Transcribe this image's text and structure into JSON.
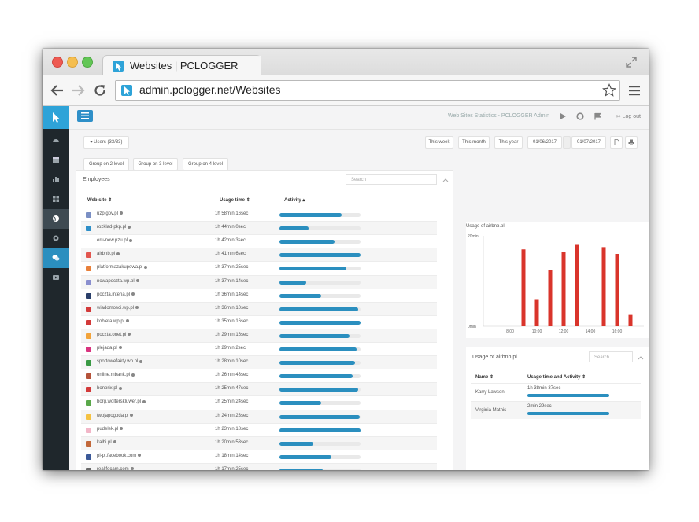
{
  "browser": {
    "tab_title": "Websites | PCLOGGER",
    "address": "admin.pclogger.net/Websites"
  },
  "topbar": {
    "title": "Web Sites Statistics - PCLOGGER Admin",
    "logout_label": "Log out"
  },
  "filters": {
    "users_label": "Users (33/33)",
    "this_week": "This week",
    "this_month": "This month",
    "this_year": "This year",
    "date_from": "01/06/2017",
    "date_sep": "-",
    "date_to": "01/07/2017",
    "group_buttons": [
      "Group on 2 level",
      "Group on 3 level",
      "Group on 4 level"
    ]
  },
  "employees": {
    "title": "Employees",
    "search_placeholder": "Search",
    "columns": [
      "Web site",
      "Usage time",
      "Activity"
    ],
    "rows": [
      {
        "site": "uzp.gov.pl",
        "time": "1h 58min 16sec",
        "activity": 0.77,
        "icon_color": "#7a8fc4"
      },
      {
        "site": "rozklad-pkp.pl",
        "time": "1h 44min 0sec",
        "activity": 0.36,
        "icon_color": "#2e8fc8"
      },
      {
        "site": "eru-new.pzu.pl",
        "time": "1h 42min 3sec",
        "activity": 0.68,
        "icon_color": "#ffffff"
      },
      {
        "site": "airbnb.pl",
        "time": "1h 41min 6sec",
        "activity": 1.0,
        "icon_color": "#e2564f"
      },
      {
        "site": "platformazakupowa.pl",
        "time": "1h 37min 25sec",
        "activity": 0.83,
        "icon_color": "#e8803a"
      },
      {
        "site": "nowapoczta.wp.pl",
        "time": "1h 37min 14sec",
        "activity": 0.33,
        "icon_color": "#8a8fcf"
      },
      {
        "site": "poczta.interia.pl",
        "time": "1h 36min 14sec",
        "activity": 0.51,
        "icon_color": "#2a3f6a"
      },
      {
        "site": "wiadomosci.wp.pl",
        "time": "1h 36min 10sec",
        "activity": 0.97,
        "icon_color": "#d33a3a"
      },
      {
        "site": "kobieta.wp.pl",
        "time": "1h 35min 16sec",
        "activity": 1.0,
        "icon_color": "#d33a3a"
      },
      {
        "site": "poczta.onet.pl",
        "time": "1h 29min 16sec",
        "activity": 0.86,
        "icon_color": "#f2a33a"
      },
      {
        "site": "plejada.pl",
        "time": "1h 29min 2sec",
        "activity": 0.95,
        "icon_color": "#d9347f"
      },
      {
        "site": "sportowefakty.wp.pl",
        "time": "1h 28min 10sec",
        "activity": 0.93,
        "icon_color": "#3a9a44"
      },
      {
        "site": "online.mbank.pl",
        "time": "1h 26min 43sec",
        "activity": 0.9,
        "icon_color": "#b5533a"
      },
      {
        "site": "bonprix.pl",
        "time": "1h 25min 47sec",
        "activity": 0.97,
        "icon_color": "#d33a3a"
      },
      {
        "site": "borg.wolterskluwer.pl",
        "time": "1h 25min 24sec",
        "activity": 0.51,
        "icon_color": "#5aa84a"
      },
      {
        "site": "twojapogoda.pl",
        "time": "1h 24min 23sec",
        "activity": 0.99,
        "icon_color": "#f5c242"
      },
      {
        "site": "pudelek.pl",
        "time": "1h 23min 18sec",
        "activity": 1.0,
        "icon_color": "#f2b6c8"
      },
      {
        "site": "kalbi.pl",
        "time": "1h 20min 53sec",
        "activity": 0.42,
        "icon_color": "#c2683a"
      },
      {
        "site": "pl-pl.facebook.com",
        "time": "1h 18min 14sec",
        "activity": 0.64,
        "icon_color": "#3b5998"
      },
      {
        "site": "realifecam.com",
        "time": "1h 17min 25sec",
        "activity": 0.53,
        "icon_color": "#6a6a6a"
      }
    ]
  },
  "chart_data": {
    "type": "bar",
    "title": "Usage of airbnb.pl",
    "ylim": [
      0,
      20
    ],
    "y_ticks": [
      "20min",
      "0min"
    ],
    "x_ticks": [
      "8:00",
      "10:00",
      "12:00",
      "14:00",
      "16:00"
    ],
    "x_range": [
      6,
      18
    ],
    "x": [
      9,
      10,
      11,
      12,
      13,
      15,
      16,
      17
    ],
    "values": [
      17,
      6,
      12.5,
      16.5,
      18,
      17.5,
      16,
      2.5
    ],
    "color": "#d9342b"
  },
  "usage_panel": {
    "title": "Usage of airbnb.pl",
    "search_placeholder": "Search",
    "columns": [
      "Name",
      "Usage time and Activity"
    ],
    "rows": [
      {
        "name": "Karry Lawson",
        "time": "1h 38min 37sec",
        "activity": 1.0
      },
      {
        "name": "Virginia Mathis",
        "time": "2min 29sec",
        "activity": 1.0
      }
    ]
  },
  "colors": {
    "accent": "#2e8fc8",
    "sidebar": "#1f272c",
    "bar": "#d9342b"
  }
}
